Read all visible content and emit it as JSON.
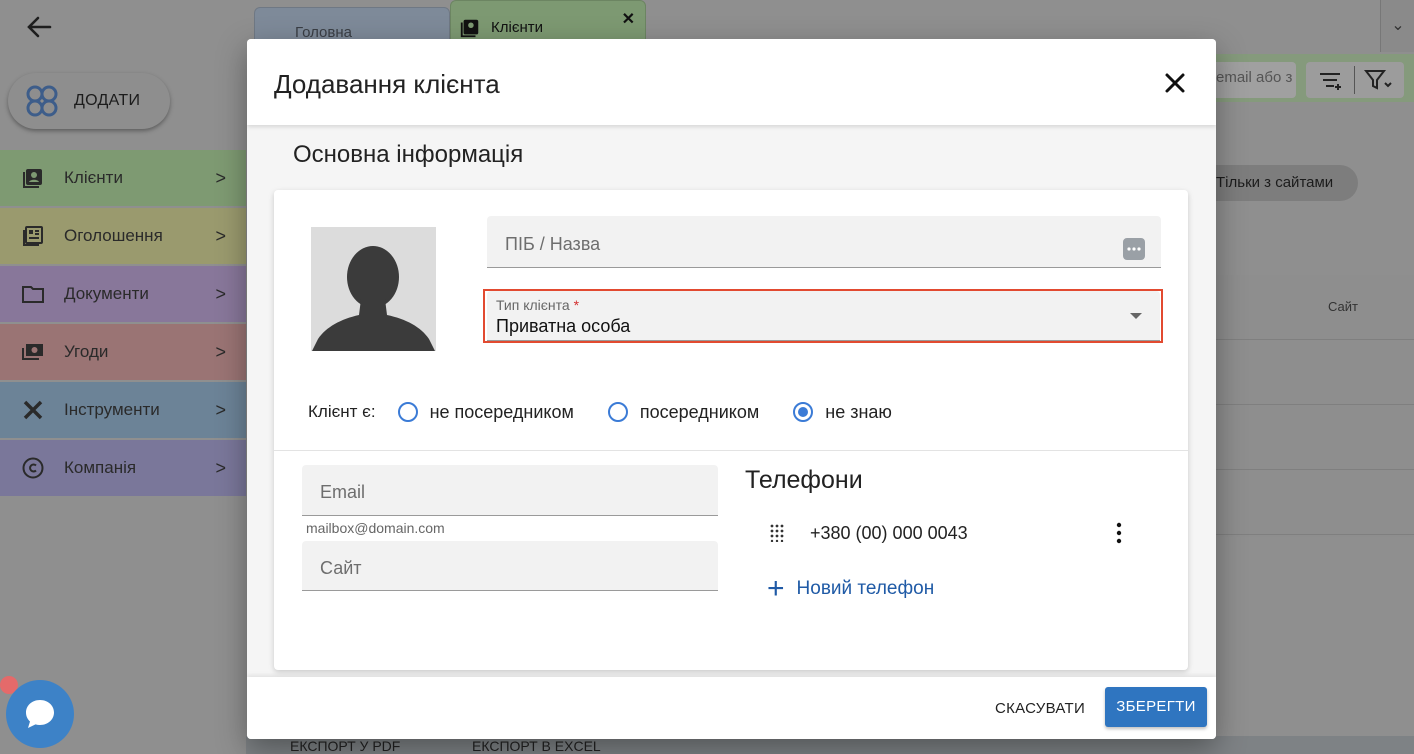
{
  "background": {
    "add_button_label": "ДОДАТИ",
    "nav": [
      {
        "label": "Клієнти",
        "icon": "contacts-icon",
        "color": "#7e9a72"
      },
      {
        "label": "Оголошення",
        "icon": "listing-icon",
        "color": "#9a9a6e"
      },
      {
        "label": "Документи",
        "icon": "folder-icon",
        "color": "#88779a"
      },
      {
        "label": "Угоди",
        "icon": "money-icon",
        "color": "#9a7474"
      },
      {
        "label": "Інструменти",
        "icon": "tools-icon",
        "color": "#6c8397"
      },
      {
        "label": "Компанія",
        "icon": "copyright-icon",
        "color": "#7a779a"
      }
    ],
    "tabs": [
      {
        "label": "Головна"
      },
      {
        "label": "Клієнти"
      }
    ],
    "search_fragment": "email або з",
    "filter_chip": "Тільки з сайтами",
    "table_header_site": "Сайт",
    "export_pdf": "ЕКСПОРТ У PDF",
    "export_excel": "ЕКСПОРТ В EXCEL"
  },
  "dialog": {
    "title": "Додавання клієнта",
    "section_title": "Основна інформація",
    "name_placeholder": "ПІБ / Назва",
    "client_type": {
      "label": "Тип клієнта",
      "required_mark": "*",
      "value": "Приватна особа"
    },
    "intermediary": {
      "lead": "Клієнт є:",
      "options": [
        {
          "label": "не посередником",
          "selected": false
        },
        {
          "label": "посередником",
          "selected": false
        },
        {
          "label": "не знаю",
          "selected": true
        }
      ]
    },
    "email_placeholder": "Email",
    "email_hint": "mailbox@domain.com",
    "site_placeholder": "Сайт",
    "phones_title": "Телефони",
    "phones": [
      {
        "number": "+380 (00) 000 0043"
      }
    ],
    "new_phone_label": "Новий телефон",
    "cancel_label": "СКАСУВАТИ",
    "save_label": "ЗБЕРЕГТИ"
  },
  "colors": {
    "accent": "#2f75c0",
    "radio": "#3b7bd6",
    "highlight": "#e24a30",
    "link": "#1f5aa6"
  }
}
